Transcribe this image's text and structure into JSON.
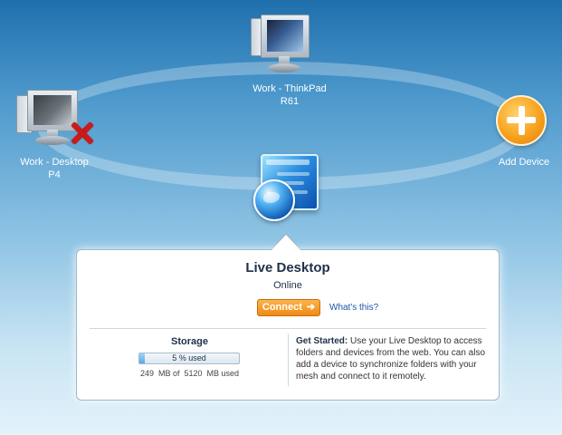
{
  "devices": [
    {
      "name_line1": "Work - ThinkPad",
      "name_line2": "R61",
      "status": "online"
    },
    {
      "name_line1": "Work - Desktop",
      "name_line2": "P4",
      "status": "offline"
    },
    {
      "name_line1": "Add Device",
      "name_line2": ""
    }
  ],
  "icons": {
    "laptop": "computer-icon",
    "desktop": "computer-offline-icon",
    "offline_badge": "red-x-icon",
    "add": "add-plus-icon",
    "live_desktop": "live-desktop-globe-icon"
  },
  "panel": {
    "title": "Live Desktop",
    "status": "Online",
    "connect_label": "Connect",
    "connect_arrow": "➔",
    "whats_this": "What's this?",
    "storage": {
      "title": "Storage",
      "used_percent": 5,
      "used_label": "5 % used",
      "usage_text": "249  MB of  5120  MB used"
    },
    "get_started": {
      "lead": "Get Started:",
      "body": " Use your Live Desktop to access folders and devices from the web. You can also add a device to synchronize folders with your mesh and connect to it remotely."
    }
  },
  "colors": {
    "accent_orange": "#f08a16",
    "link_blue": "#1b57a8",
    "error_red": "#cc1a1a"
  }
}
